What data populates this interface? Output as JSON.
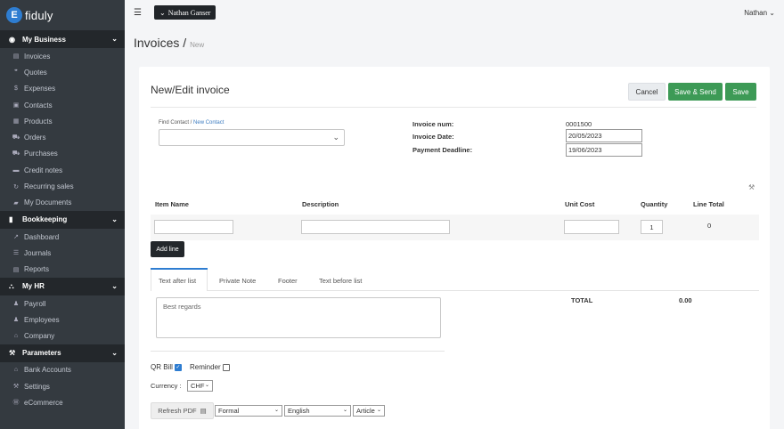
{
  "brand": {
    "name": "fiduly",
    "logo_letter": "E"
  },
  "sidebar": {
    "sections": [
      {
        "title": "My Business",
        "items": [
          "Invoices",
          "Quotes",
          "Expenses",
          "Contacts",
          "Products",
          "Orders",
          "Purchases",
          "Credit notes",
          "Recurring sales",
          "My Documents"
        ]
      },
      {
        "title": "Bookkeeping",
        "items": [
          "Dashboard",
          "Journals",
          "Reports"
        ]
      },
      {
        "title": "My HR",
        "items": [
          "Payroll",
          "Employees",
          "Company"
        ]
      },
      {
        "title": "Parameters",
        "items": [
          "Bank Accounts",
          "Settings",
          "eCommerce"
        ]
      }
    ]
  },
  "topbar": {
    "account_dropdown": "Nathan Ganser",
    "user_menu": "Nathan"
  },
  "breadcrumb": {
    "title": "Invoices /",
    "current": "New"
  },
  "form": {
    "title": "New/Edit invoice",
    "cancel_label": "Cancel",
    "save_send_label": "Save & Send",
    "save_label": "Save",
    "find_contact_label": "Find Contact /",
    "new_contact_link": "New Contact",
    "invoice_num_label": "Invoice num:",
    "invoice_num_value": "0001500",
    "invoice_date_label": "Invoice Date:",
    "invoice_date_value": "20/05/2023",
    "deadline_label": "Payment Deadline:",
    "deadline_value": "19/06/2023"
  },
  "items_table": {
    "headers": {
      "name": "Item Name",
      "description": "Description",
      "unit_cost": "Unit Cost",
      "quantity": "Quantity",
      "line_total": "Line Total"
    },
    "row": {
      "name": "",
      "description": "",
      "unit_cost": "",
      "quantity": "1",
      "line_total": "0"
    },
    "add_line_label": "Add line"
  },
  "tabs": [
    "Text after list",
    "Private Note",
    "Footer",
    "Text before list"
  ],
  "after_list_text_placeholder": "Best regards",
  "totals": {
    "label": "TOTAL",
    "value": "0.00"
  },
  "options": {
    "qr_bill_label": "QR Bill",
    "qr_bill_checked": true,
    "reminder_label": "Reminder",
    "reminder_checked": false,
    "currency_label": "Currency :",
    "currency_value": "CHF"
  },
  "pdf": {
    "refresh_label": "Refresh PDF",
    "style_value": "Formal",
    "language_value": "English",
    "layout_value": "Article"
  },
  "colors": {
    "accent": "#2e7dd1",
    "success": "#3d9a56",
    "sidebar_bg": "#343a40"
  }
}
